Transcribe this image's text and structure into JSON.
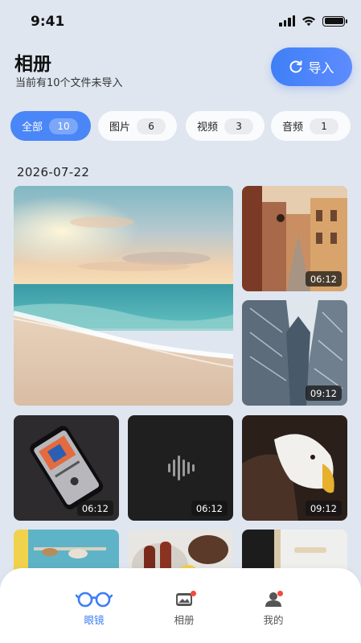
{
  "status": {
    "time": "9:41"
  },
  "header": {
    "title": "相册",
    "subtitle": "当前有10个文件未导入"
  },
  "import_button": {
    "label": "导入"
  },
  "filters": [
    {
      "label": "全部",
      "count": "10",
      "active": true
    },
    {
      "label": "图片",
      "count": "6",
      "active": false
    },
    {
      "label": "视频",
      "count": "3",
      "active": false
    },
    {
      "label": "音频",
      "count": "1",
      "active": false
    }
  ],
  "date_group": "2026-07-22",
  "media": [
    {
      "name": "beach-sunset-photo",
      "type": "image"
    },
    {
      "name": "street-video",
      "type": "video",
      "duration": "06:12"
    },
    {
      "name": "skyscraper-video",
      "type": "video",
      "duration": "09:12"
    },
    {
      "name": "phone-music-video",
      "type": "video",
      "duration": "06:12"
    },
    {
      "name": "audio-file",
      "type": "audio",
      "duration": "06:12"
    },
    {
      "name": "eagle-video",
      "type": "video",
      "duration": "09:12"
    },
    {
      "name": "kitchen-photo",
      "type": "image"
    },
    {
      "name": "food-photo",
      "type": "image"
    },
    {
      "name": "door-photo",
      "type": "image"
    }
  ],
  "tabbar": {
    "tabs": [
      {
        "label": "眼镜",
        "icon": "glasses-icon",
        "active": true
      },
      {
        "label": "相册",
        "icon": "album-icon",
        "badge": true
      },
      {
        "label": "我的",
        "icon": "profile-icon",
        "badge": true
      }
    ]
  },
  "colors": {
    "accent": "#4a86f7",
    "background": "#dfe6f0",
    "badge": "#f24b3f"
  }
}
